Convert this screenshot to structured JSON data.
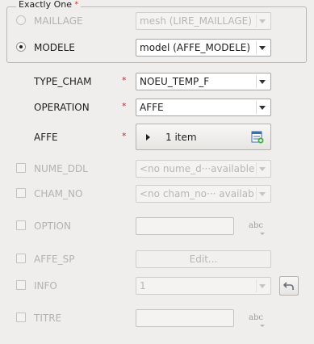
{
  "group": {
    "title": "Exactly One",
    "required_mark": "*"
  },
  "options": [
    {
      "label": "MAILLAGE",
      "value": "mesh (LIRE_MAILLAGE)",
      "selected": false,
      "enabled": false
    },
    {
      "label": "MODELE",
      "value": "model (AFFE_MODELE)",
      "selected": true,
      "enabled": true
    }
  ],
  "fields": {
    "type_cham": {
      "label": "TYPE_CHAM",
      "required": "*",
      "value": "NOEU_TEMP_F"
    },
    "operation": {
      "label": "OPERATION",
      "required": "*",
      "value": "AFFE"
    },
    "affe": {
      "label": "AFFE",
      "required": "*",
      "value": "1 item",
      "icon": "table-add-icon"
    },
    "nume_ddl": {
      "label": "NUME_DDL",
      "value": "<no nume_d···available>"
    },
    "cham_no": {
      "label": "CHAM_NO",
      "value": "<no cham_no··· available"
    },
    "option": {
      "label": "OPTION",
      "value": "",
      "abc": "abc"
    },
    "affe_sp": {
      "label": "AFFE_SP",
      "button": "Edit..."
    },
    "info": {
      "label": "INFO",
      "value": "1",
      "reset_icon": "undo-arrow-icon"
    },
    "titre": {
      "label": "TITRE",
      "value": "",
      "abc": "abc"
    }
  },
  "colors": {
    "required": "#d42020",
    "accent": "#3a7fd0"
  }
}
